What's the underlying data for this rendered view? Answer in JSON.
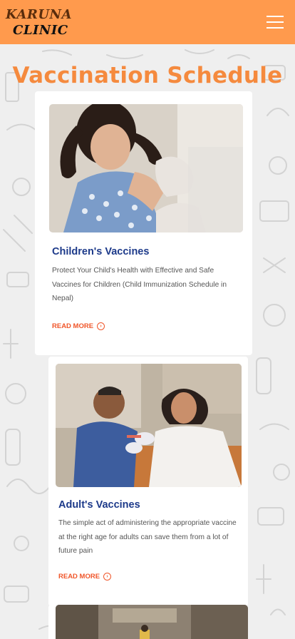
{
  "brand": {
    "line1": "KARUNA",
    "line2": "CLINIC"
  },
  "nav": {
    "menu_icon": "hamburger-menu-icon"
  },
  "page": {
    "title": "Vaccination Schedule"
  },
  "cards": [
    {
      "title": "Children's Vaccines",
      "description": "Protect Your Child's Health with Effective and Safe Vaccines for Children (Child Immunization Schedule in Nepal)",
      "read_more": "READ MORE",
      "image": "child-vaccination-photo"
    },
    {
      "title": "Adult's Vaccines",
      "description": "The simple act of administering the appropriate vaccine at the right age for adults can save them from a lot of future pain",
      "read_more": "READ MORE",
      "image": "adult-vaccination-photo"
    },
    {
      "image": "street-scene-photo"
    }
  ],
  "colors": {
    "nav_bg": "#ff9a4d",
    "title": "#f58a3e",
    "card_title": "#1d3a8a",
    "read_more": "#f0562a"
  }
}
